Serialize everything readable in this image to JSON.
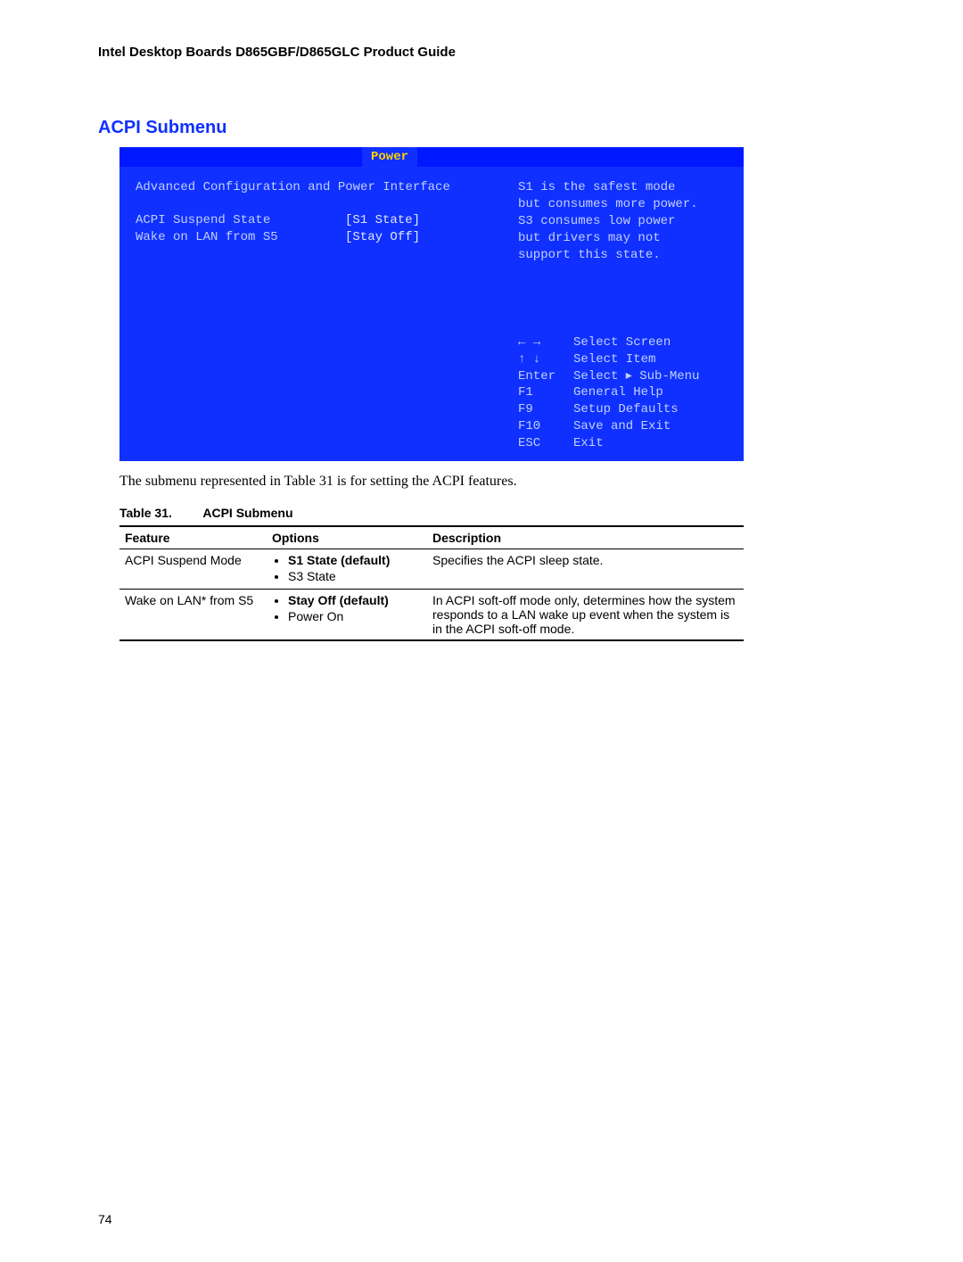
{
  "doc_header": "Intel Desktop Boards D865GBF/D865GLC Product Guide",
  "section_title": "ACPI Submenu",
  "bios": {
    "active_tab": "Power",
    "panel_title": "Advanced Configuration and Power Interface",
    "rows": [
      {
        "key": "ACPI Suspend State",
        "value": "[S1 State]"
      },
      {
        "key": "Wake on LAN from S5",
        "value": "[Stay Off]"
      }
    ],
    "help_lines": [
      "S1 is the safest mode",
      "but consumes more power.",
      "S3 consumes low power",
      "but drivers may not",
      "support this state."
    ],
    "keys": [
      {
        "k": "← →",
        "d": "Select Screen"
      },
      {
        "k": "↑ ↓",
        "d": "Select Item"
      },
      {
        "k": "Enter",
        "d": "Select ▸ Sub-Menu"
      },
      {
        "k": "F1",
        "d": "General Help"
      },
      {
        "k": "F9",
        "d": "Setup Defaults"
      },
      {
        "k": "F10",
        "d": "Save and Exit"
      },
      {
        "k": "ESC",
        "d": "Exit"
      }
    ]
  },
  "submenu_caption": "The submenu represented in Table 31 is for setting the ACPI features.",
  "table": {
    "number": "Table 31.",
    "title": "ACPI Submenu",
    "headers": {
      "feature": "Feature",
      "options": "Options",
      "description": "Description"
    },
    "rows": [
      {
        "feature": "ACPI Suspend Mode",
        "options": [
          {
            "label": "S1 State (default)",
            "default": true
          },
          {
            "label": "S3 State",
            "default": false
          }
        ],
        "description": "Specifies the ACPI sleep state."
      },
      {
        "feature": "Wake on LAN* from S5",
        "options": [
          {
            "label": "Stay Off (default)",
            "default": true
          },
          {
            "label": "Power On",
            "default": false
          }
        ],
        "description": "In ACPI soft-off mode only, determines how the system responds to a LAN wake up event when the system is in the ACPI soft-off mode."
      }
    ]
  },
  "page_number": "74"
}
